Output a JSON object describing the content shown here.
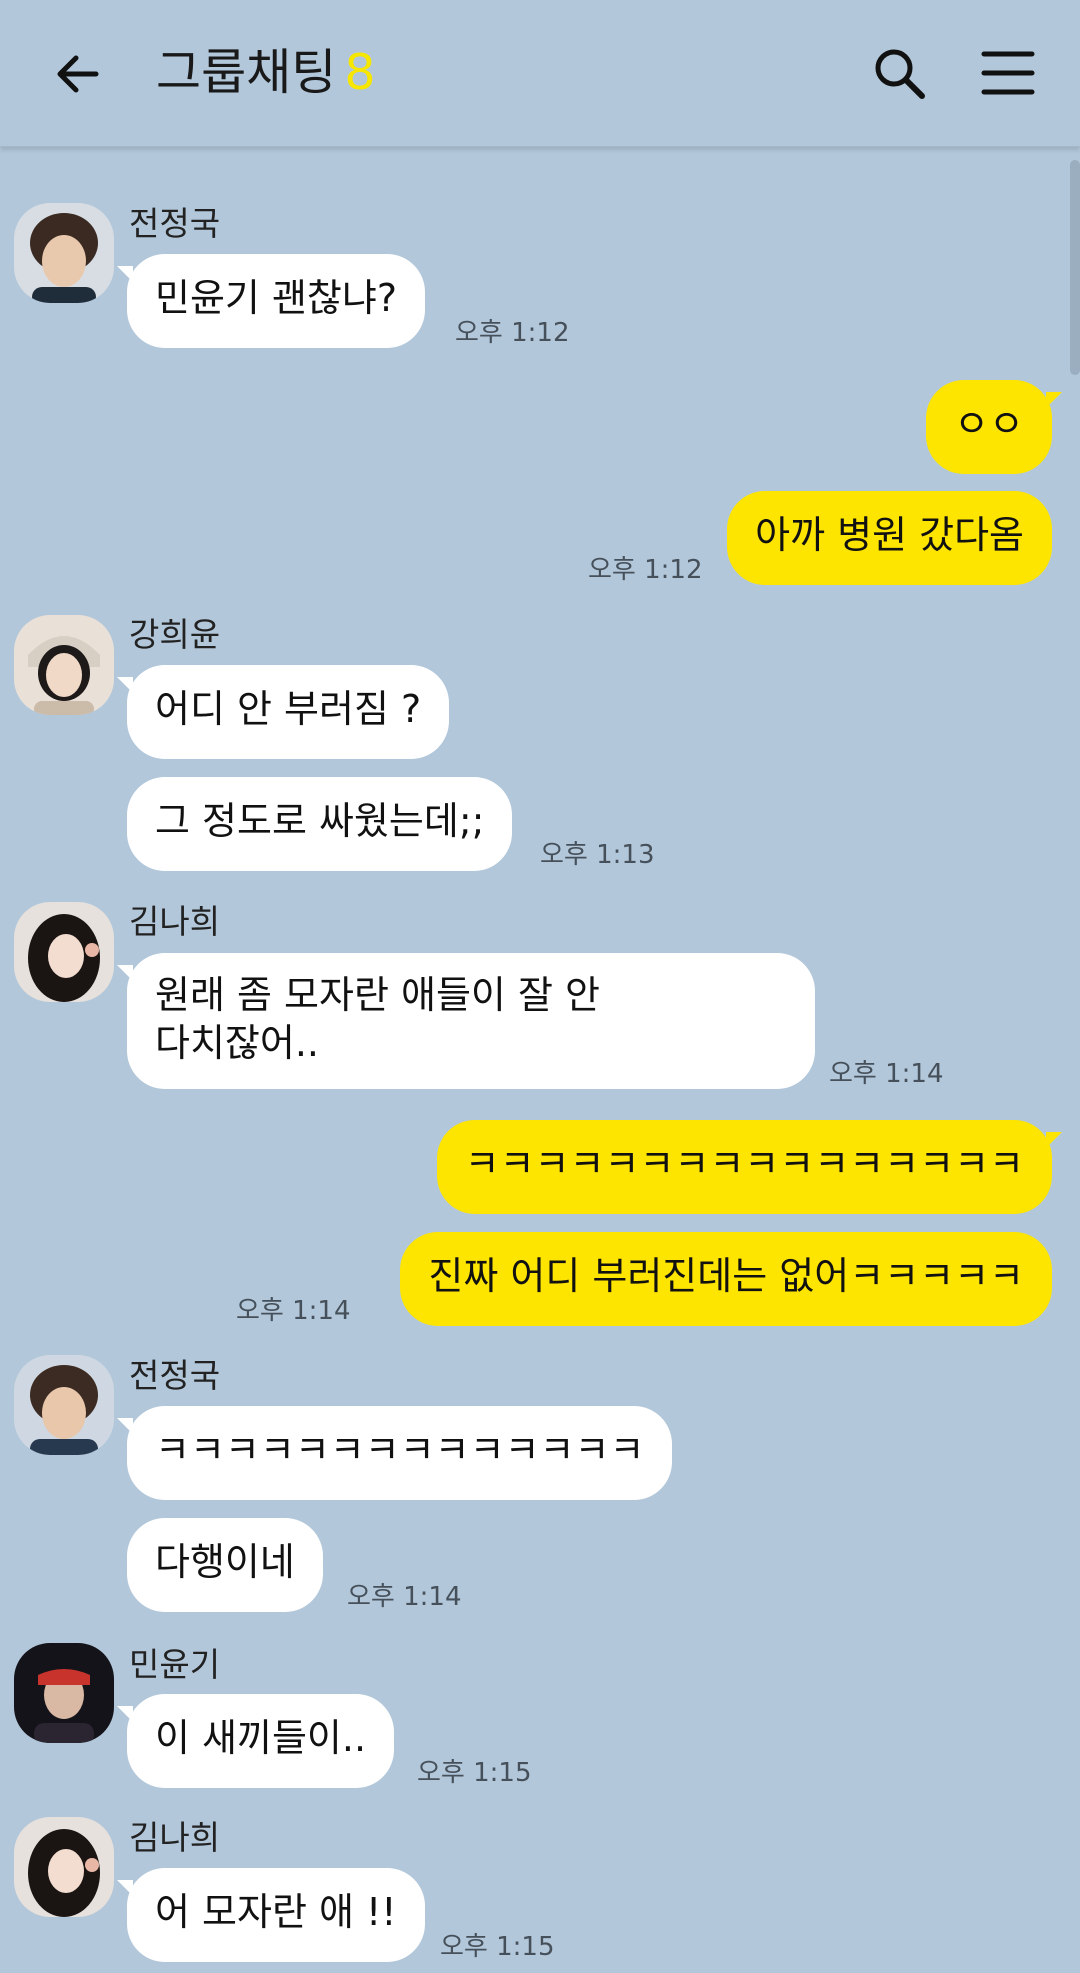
{
  "header": {
    "title": "그룹채팅",
    "member_count": "8",
    "back_icon": "arrow-left-icon",
    "search_icon": "search-icon",
    "menu_icon": "hamburger-menu-icon"
  },
  "colors": {
    "background": "#b2c7da",
    "outgoing_bubble": "#fee500",
    "incoming_bubble": "#ffffff",
    "member_count": "#f7e600"
  },
  "messages": [
    {
      "sender": "전정국",
      "text": "민윤기 괜찮냐?",
      "time": "오후 1:12"
    },
    {
      "text": "ㅇㅇ"
    },
    {
      "text": "아까 병원 갔다옴",
      "time": "오후 1:12"
    },
    {
      "sender": "강희윤",
      "text": "어디 안 부러짐 ?"
    },
    {
      "text": "그 정도로 싸웠는데;;",
      "time": "오후 1:13"
    },
    {
      "sender": "김나희",
      "text_line1": "원래 좀 모자란 애들이 잘 안",
      "text_line2": "다치잖어..",
      "time": "오후 1:14"
    },
    {
      "text": "ㅋㅋㅋㅋㅋㅋㅋㅋㅋㅋㅋㅋㅋㅋㅋㅋ"
    },
    {
      "text": "진짜 어디 부러진데는 없어ㅋㅋㅋㅋㅋ",
      "time": "오후 1:14"
    },
    {
      "sender": "전정국",
      "text": "ㅋㅋㅋㅋㅋㅋㅋㅋㅋㅋㅋㅋㅋㅋ"
    },
    {
      "text": "다행이네",
      "time": "오후 1:14"
    },
    {
      "sender": "민윤기",
      "text": "이 새끼들이..",
      "time": "오후 1:15"
    },
    {
      "sender": "김나희",
      "text": "어 모자란 애 !!",
      "time": "오후 1:15"
    }
  ]
}
